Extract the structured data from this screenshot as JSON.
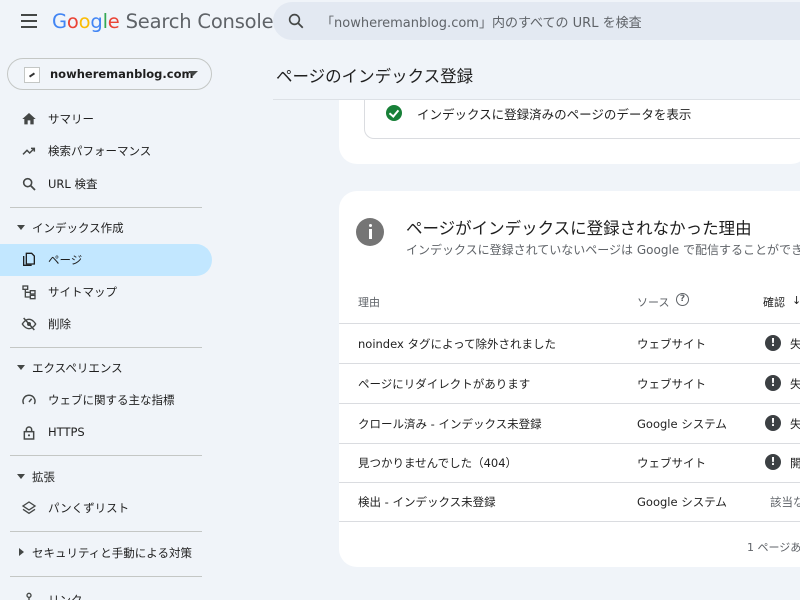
{
  "header": {
    "app_name_google": [
      "G",
      "o",
      "o",
      "g",
      "l",
      "e"
    ],
    "app_name_suffix": "Search Console",
    "search_placeholder": "「nowheremanblog.com」内のすべての URL を検査"
  },
  "property": {
    "name": "nowheremanblog.com"
  },
  "sidebar": {
    "items_top": [
      {
        "label": "サマリー",
        "icon": "home-icon"
      },
      {
        "label": "検索パフォーマンス",
        "icon": "trending-up-icon"
      },
      {
        "label": "URL 検査",
        "icon": "search-icon"
      }
    ],
    "section_index": "インデックス作成",
    "items_index": [
      {
        "label": "ページ",
        "icon": "pages-icon",
        "active": true
      },
      {
        "label": "サイトマップ",
        "icon": "sitemap-icon"
      },
      {
        "label": "削除",
        "icon": "visibility-off-icon"
      }
    ],
    "section_experience": "エクスペリエンス",
    "items_experience": [
      {
        "label": "ウェブに関する主な指標",
        "icon": "speed-icon"
      },
      {
        "label": "HTTPS",
        "icon": "lock-icon"
      }
    ],
    "section_enhancements": "拡張",
    "items_enhancements": [
      {
        "label": "パンくずリスト",
        "icon": "layers-icon"
      }
    ],
    "section_security": "セキュリティと手動による対策",
    "items_bottom": [
      {
        "label": "リンク",
        "icon": "links-icon"
      }
    ]
  },
  "page": {
    "title": "ページのインデックス登録"
  },
  "indexed_card": {
    "link_text": "インデックスに登録済みのページのデータを表示"
  },
  "not_indexed_card": {
    "title": "ページがインデックスに登録されなかった理由",
    "subtitle": "インデックスに登録されていないページは Google で配信することができ",
    "columns": {
      "reason": "理由",
      "source": "ソース",
      "validation": "確認"
    },
    "rows": [
      {
        "reason": "noindex タグによって除外されました",
        "source": "ウェブサイト",
        "status": "失",
        "warn": true
      },
      {
        "reason": "ページにリダイレクトがあります",
        "source": "ウェブサイト",
        "status": "失",
        "warn": true
      },
      {
        "reason": "クロール済み - インデックス未登録",
        "source": "Google システム",
        "status": "失",
        "warn": true
      },
      {
        "reason": "見つかりませんでした（404）",
        "source": "ウェブサイト",
        "status": "開",
        "warn": true
      },
      {
        "reason": "検出 - インデックス未登録",
        "source": "Google システム",
        "status": "該当な",
        "warn": false
      }
    ],
    "pagination": "1 ページあ"
  },
  "colors": {
    "accent_active": "#c2e7ff",
    "success": "#188038",
    "background": "#f0f4f9"
  }
}
